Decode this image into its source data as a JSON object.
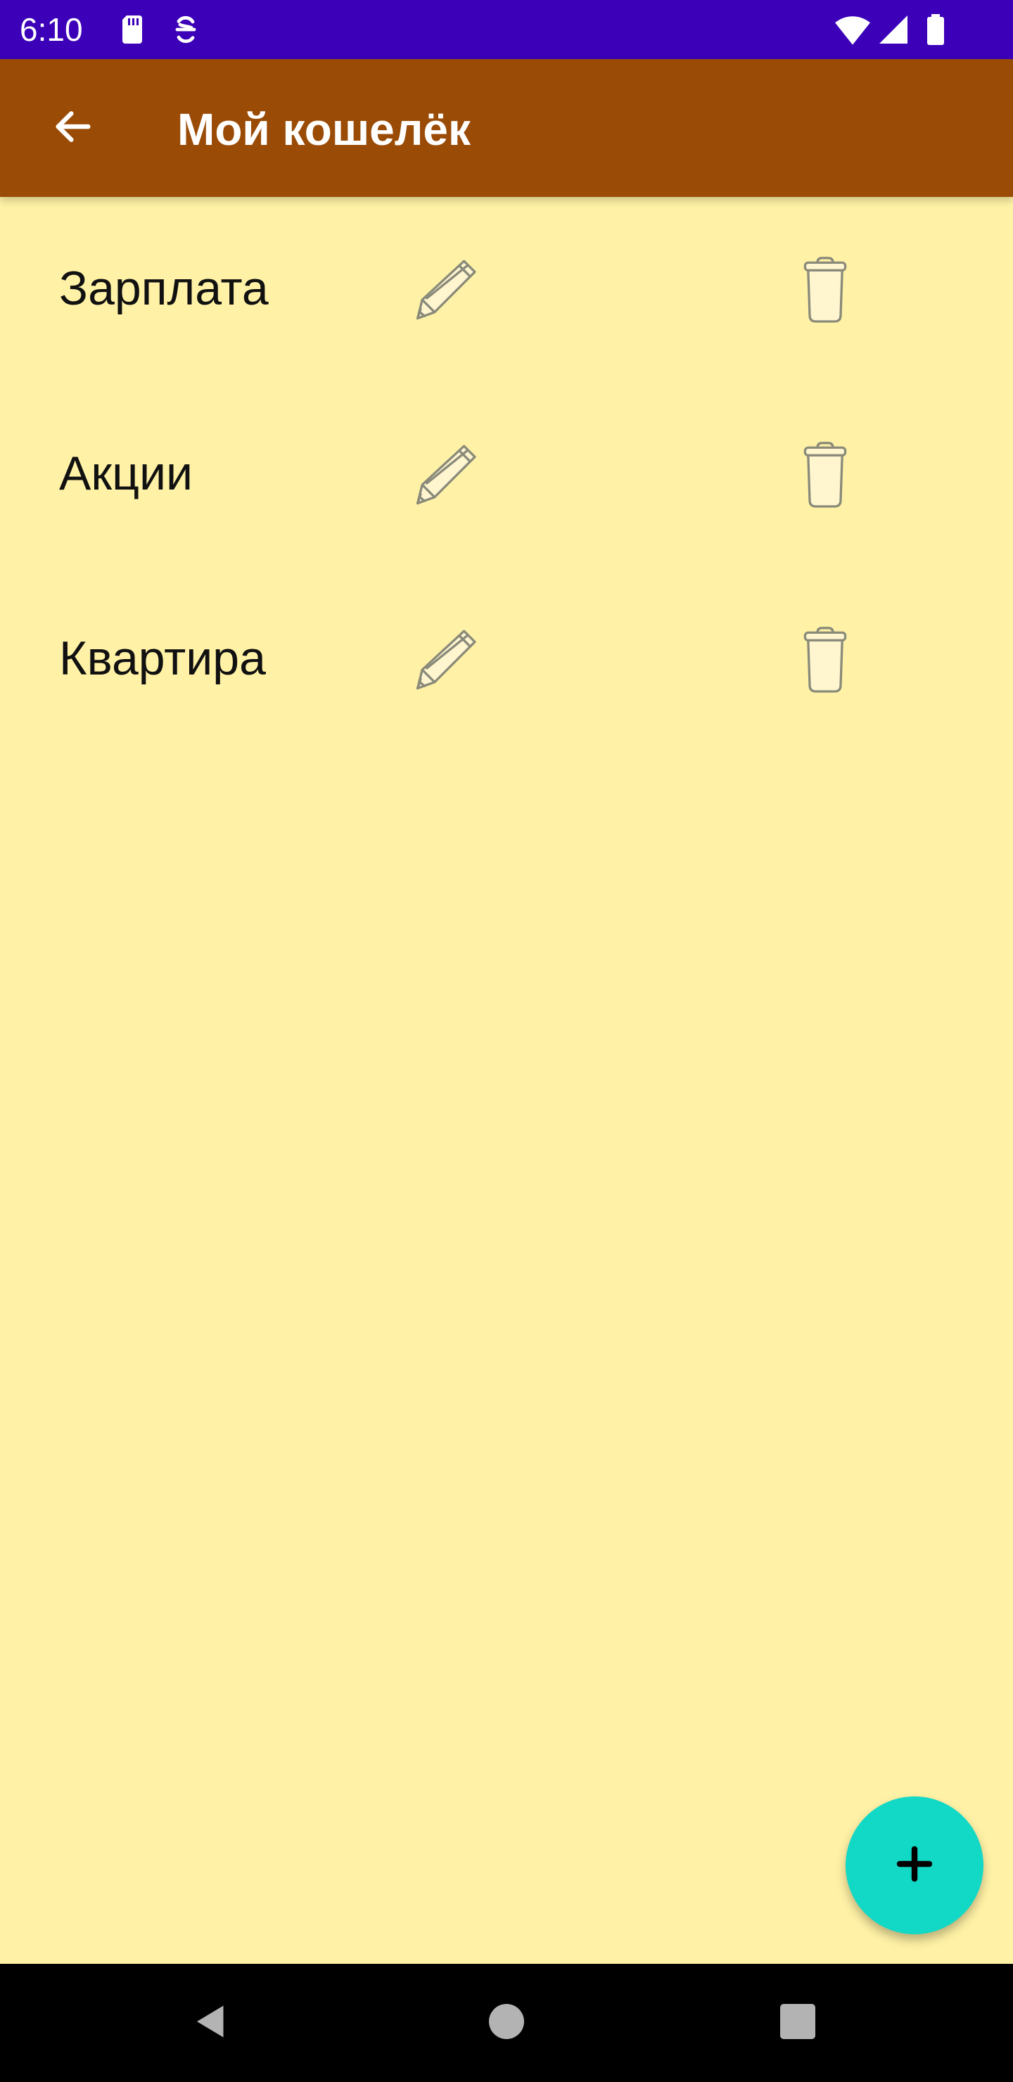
{
  "status_bar": {
    "time": "6:10",
    "icons": [
      "sd-card-icon",
      "sync-icon",
      "wifi-icon",
      "signal-icon",
      "battery-icon"
    ]
  },
  "app_bar": {
    "title": "Мой кошелёк",
    "back_icon": "arrow-left-icon"
  },
  "wallets": [
    {
      "name": "Зарплата"
    },
    {
      "name": "Акции"
    },
    {
      "name": "Квартира"
    }
  ],
  "fab": {
    "icon": "plus-icon"
  },
  "nav_bar": {
    "icons": [
      "back-triangle-icon",
      "home-circle-icon",
      "recents-square-icon"
    ]
  },
  "colors": {
    "status_bar": "#3B00B8",
    "app_bar": "#9A4C06",
    "background": "#FFF2A6",
    "fab": "#12D8C6",
    "icon_outline": "#8A8A7A"
  }
}
